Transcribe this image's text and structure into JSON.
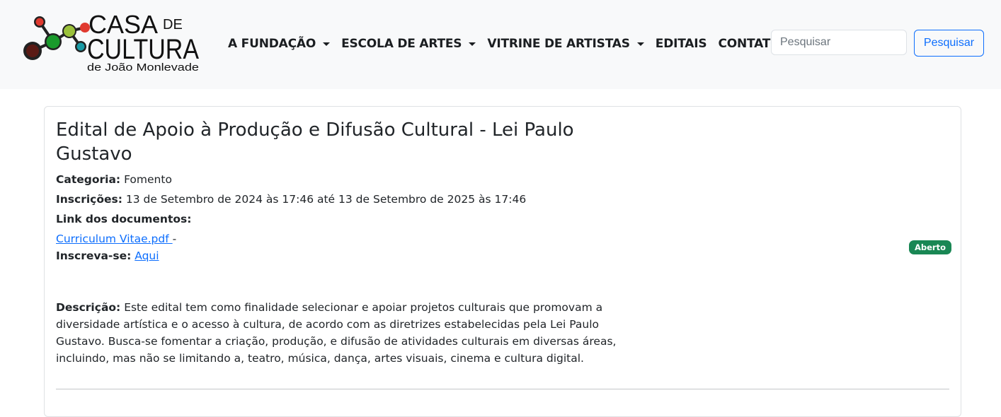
{
  "brand": {
    "line1": "CASA",
    "line1_suffix": "DE",
    "line2": "CULTURA",
    "line3": "de João Monlevade",
    "colors": [
      "#e03a2f",
      "#1a9a2c",
      "#9bc13b",
      "#1a9aa5",
      "#222222"
    ]
  },
  "nav": {
    "items": [
      {
        "label": "A FUNDAÇÃO",
        "dropdown": true
      },
      {
        "label": "ESCOLA DE ARTES",
        "dropdown": true
      },
      {
        "label": "VITRINE DE ARTISTAS",
        "dropdown": true
      },
      {
        "label": "EDITAIS",
        "dropdown": false
      },
      {
        "label": "CONTATO",
        "dropdown": true
      }
    ],
    "search": {
      "placeholder": "Pesquisar",
      "value": "",
      "button_label": "Pesquisar"
    }
  },
  "edital": {
    "title": "Edital de Apoio à Produção e Difusão Cultural - Lei Paulo Gustavo",
    "category_label": "Categoria:",
    "category": "Fomento",
    "registrations_label": "Inscrições:",
    "registrations": "13 de Setembro de 2024 às 17:46 até 13 de Setembro de 2025 às 17:46",
    "documents_label": "Link dos documentos:",
    "document_link": "Curriculum Vitae.pdf ",
    "document_separator": "-",
    "signup_label": "Inscreva-se:",
    "signup_link": "Aqui",
    "status": "Aberto",
    "description_label": "Descrição:",
    "description": "Este edital tem como finalidade selecionar e apoiar projetos culturais que promovam a diversidade artística e o acesso à cultura, de acordo com as diretrizes estabelecidas pela Lei Paulo Gustavo. Busca-se fomentar a criação, produção, e difusão de atividades culturais em diversas áreas, incluindo, mas não se limitando a, teatro, música, dança, artes visuais, cinema e cultura digital."
  }
}
